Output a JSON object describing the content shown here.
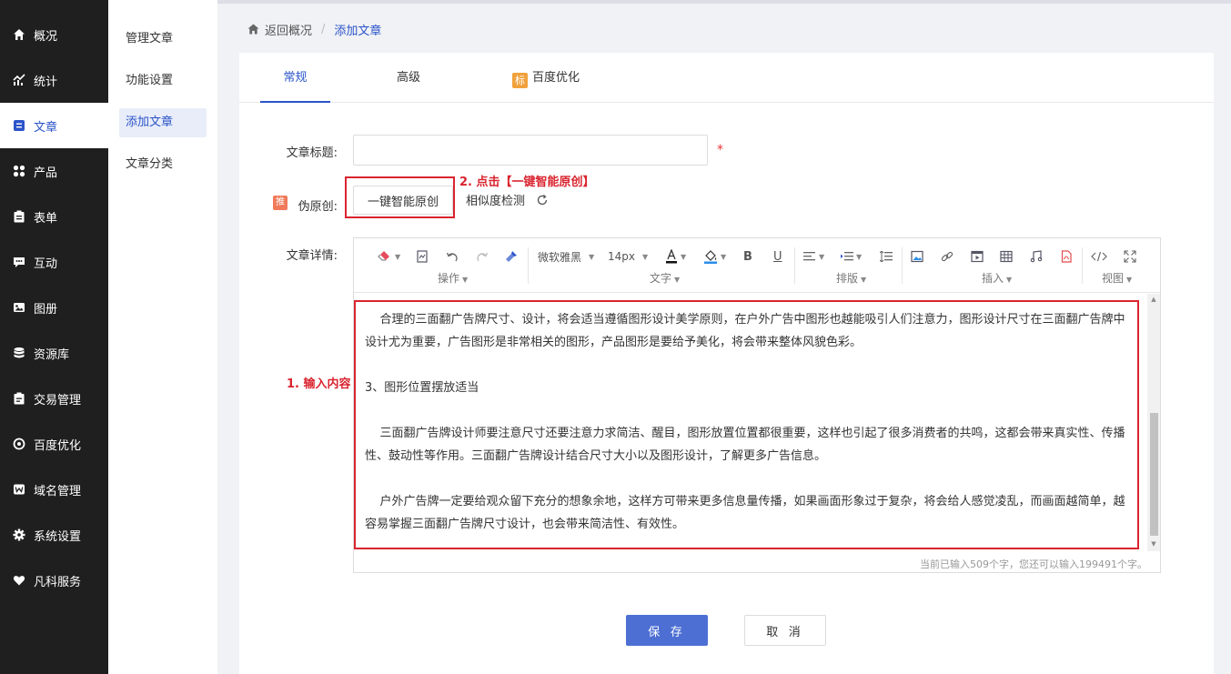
{
  "nav": {
    "items": [
      {
        "label": "概况",
        "icon": "home-icon"
      },
      {
        "label": "统计",
        "icon": "chart-icon"
      },
      {
        "label": "文章",
        "icon": "article-icon",
        "active": true
      },
      {
        "label": "产品",
        "icon": "grid-icon"
      },
      {
        "label": "表单",
        "icon": "clipboard-icon"
      },
      {
        "label": "互动",
        "icon": "message-icon"
      },
      {
        "label": "图册",
        "icon": "image-icon"
      },
      {
        "label": "资源库",
        "icon": "database-icon"
      },
      {
        "label": "交易管理",
        "icon": "order-icon"
      },
      {
        "label": "百度优化",
        "icon": "target-icon"
      },
      {
        "label": "域名管理",
        "icon": "domain-icon"
      },
      {
        "label": "系统设置",
        "icon": "gear-icon"
      },
      {
        "label": "凡科服务",
        "icon": "heart-icon"
      }
    ]
  },
  "subnav": {
    "items": [
      {
        "label": "管理文章"
      },
      {
        "label": "功能设置"
      },
      {
        "label": "添加文章",
        "active": true
      },
      {
        "label": "文章分类"
      }
    ]
  },
  "breadcrumb": {
    "back": "返回概况",
    "separator": "/",
    "current": "添加文章"
  },
  "tabs": {
    "general": "常规",
    "advanced": "高级",
    "baidu_badge": "标",
    "baidu": "百度优化"
  },
  "form": {
    "title_label": "文章标题:",
    "title_value": "",
    "required_mark": "*",
    "pseudo_badge": "推",
    "pseudo_label": "伪原创:",
    "ai_button": "一键智能原创",
    "similarity": "相似度检测",
    "detail_label": "文章详情:"
  },
  "annotations": {
    "step1": "1. 输入内容",
    "step2": "2. 点击【一键智能原创】"
  },
  "editor": {
    "font_family": "微软雅黑",
    "font_size": "14px",
    "groups": {
      "operate": "操作",
      "text": "文字",
      "layout": "排版",
      "insert": "插入",
      "view": "视图"
    },
    "paragraphs": [
      "合理的三面翻广告牌尺寸、设计，将会适当遵循图形设计美学原则，在户外广告中图形也越能吸引人们注意力，图形设计尺寸在三面翻广告牌中设计尤为重要，广告图形是非常相关的图形，产品图形是要给予美化，将会带来整体风貌色彩。",
      "3、图形位置摆放适当",
      "三面翻广告牌设计师要注意尺寸还要注意力求简洁、醒目，图形放置位置都很重要，这样也引起了很多消费者的共鸣，这都会带来真实性、传播性、鼓动性等作用。三面翻广告牌设计结合尺寸大小以及图形设计，了解更多广告信息。",
      "户外广告牌一定要给观众留下充分的想象余地，这样方可带来更多信息量传播，如果画面形象过于复杂，将会给人感觉凌乱，而画面越简单，越容易掌握三面翻广告牌尺寸设计，也会带来简洁性、有效性。"
    ],
    "counter": "当前已输入509个字，您还可以输入199491个字。"
  },
  "actions": {
    "save": "保 存",
    "cancel": "取 消"
  },
  "colors": {
    "accent": "#2b54c9",
    "annotation": "#d9242f",
    "nav_bg": "#1f1f1f"
  }
}
